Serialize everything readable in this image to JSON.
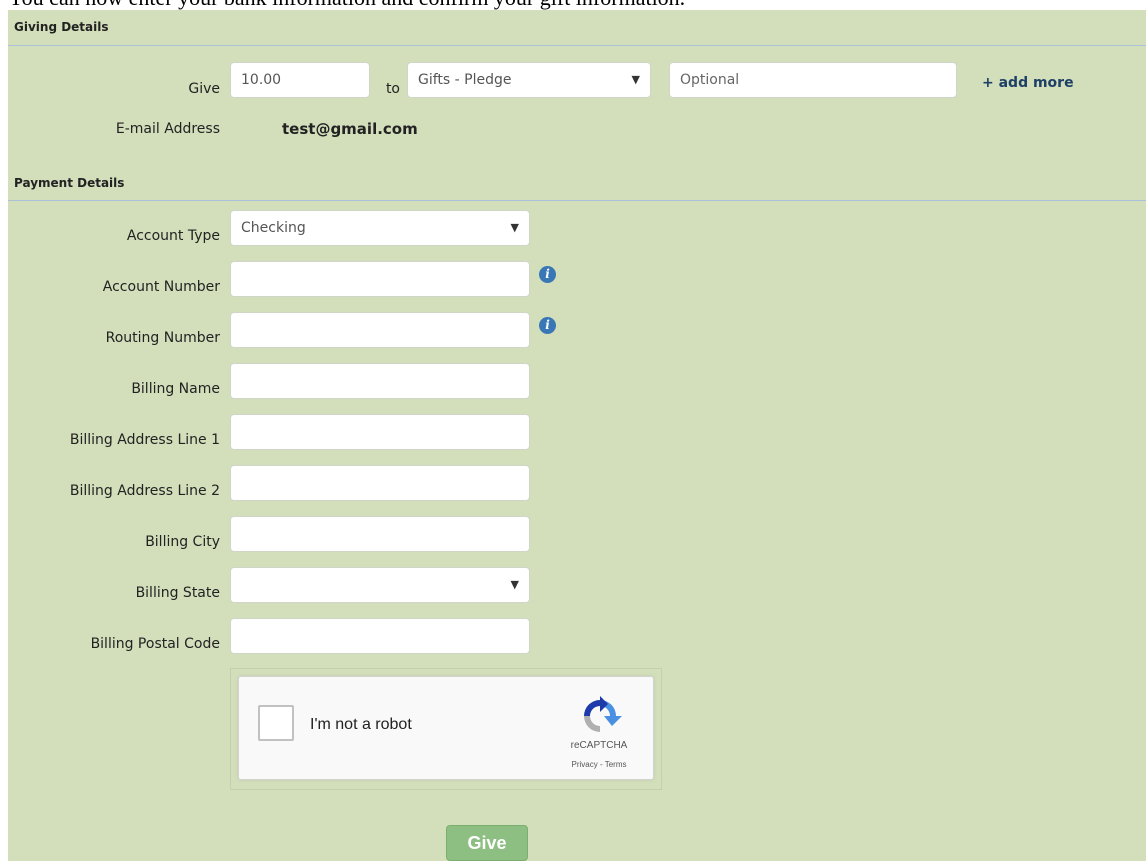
{
  "intro": "You can now enter your bank information and confirm your gift information.",
  "giving": {
    "heading": "Giving Details",
    "give_label": "Give",
    "amount": "10.00",
    "to_label": "to",
    "fund": "Gifts - Pledge",
    "memo_placeholder": "Optional",
    "add_more": "+ add more",
    "email_label": "E-mail Address",
    "email_value": "test@gmail.com"
  },
  "payment": {
    "heading": "Payment Details",
    "account_type_label": "Account Type",
    "account_type": "Checking",
    "account_number_label": "Account Number",
    "account_number": "",
    "routing_number_label": "Routing Number",
    "routing_number": "",
    "billing_name_label": "Billing Name",
    "billing_name": "",
    "address1_label": "Billing Address Line 1",
    "address1": "",
    "address2_label": "Billing Address Line 2",
    "address2": "",
    "city_label": "Billing City",
    "city": "",
    "state_label": "Billing State",
    "state": "",
    "postal_label": "Billing Postal Code",
    "postal": ""
  },
  "captcha": {
    "label": "I'm not a robot",
    "brand": "reCAPTCHA",
    "links": "Privacy - Terms"
  },
  "submit_label": "Give",
  "icons": {
    "info": "info-icon",
    "dropdown": "chevron-down-icon",
    "captcha": "recaptcha-logo-icon"
  },
  "colors": {
    "panel": "#d3dfbb",
    "link": "#1e3f66",
    "button": "#8dbf82",
    "info": "#3a78b5"
  }
}
